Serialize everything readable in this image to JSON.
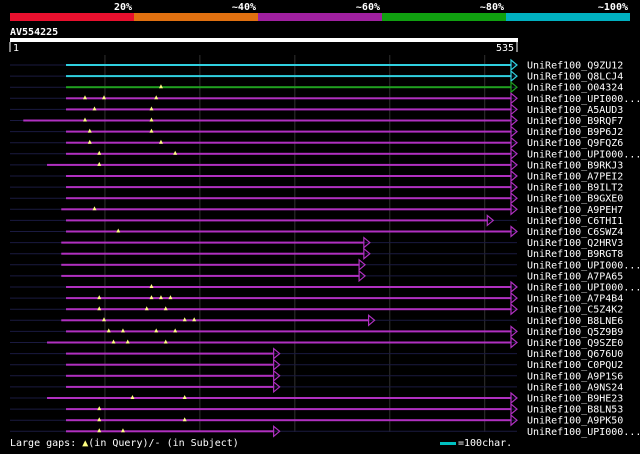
{
  "colors": {
    "band_red": "#e8102e",
    "band_orange": "#e07010",
    "band_purple": "#a020a0",
    "band_green": "#10a010",
    "band_cyan": "#00b0c0",
    "hit_purple": "#b030c0",
    "hit_cyan": "#30d0e0",
    "hit_green": "#20a020",
    "gap_marker": "#ffff80",
    "dashed": "#808080"
  },
  "identity_scale": {
    "labels": [
      "20%",
      "~40%",
      "~60%",
      "~80%",
      "~100%"
    ]
  },
  "query": {
    "name": "AV554225",
    "start_label": "1",
    "end_label": "535",
    "length": 535
  },
  "hits": [
    {
      "name": "UniRef100_Q9ZU12",
      "start": 60,
      "end": 535,
      "color": "cyan",
      "gaps": []
    },
    {
      "name": "UniRef100_Q8LCJ4",
      "start": 60,
      "end": 535,
      "color": "cyan",
      "gaps": []
    },
    {
      "name": "UniRef100_O04324",
      "start": 60,
      "end": 535,
      "color": "green",
      "gaps": [
        160
      ]
    },
    {
      "name": "UniRef100_UPI000...",
      "start": 60,
      "end": 535,
      "color": "purple",
      "gaps": [
        80,
        100,
        155
      ]
    },
    {
      "name": "UniRef100_A5AUD3",
      "start": 60,
      "end": 535,
      "color": "purple",
      "gaps": [
        90,
        150
      ]
    },
    {
      "name": "UniRef100_B9RQF7",
      "start": 15,
      "end": 535,
      "color": "purple",
      "gaps": [
        80,
        150
      ]
    },
    {
      "name": "UniRef100_B9P6J2",
      "start": 60,
      "end": 535,
      "color": "purple",
      "gaps": [
        85,
        150
      ]
    },
    {
      "name": "UniRef100_Q9FQZ6",
      "start": 60,
      "end": 535,
      "color": "purple",
      "gaps": [
        85,
        160
      ]
    },
    {
      "name": "UniRef100_UPI000...",
      "start": 60,
      "end": 535,
      "color": "purple",
      "gaps": [
        95,
        175
      ]
    },
    {
      "name": "UniRef100_B9RKJ3",
      "start": 40,
      "end": 535,
      "color": "purple",
      "gaps": [
        95
      ]
    },
    {
      "name": "UniRef100_A7PEI2",
      "start": 60,
      "end": 535,
      "color": "purple",
      "gaps": []
    },
    {
      "name": "UniRef100_B9ILT2",
      "start": 60,
      "end": 535,
      "color": "purple",
      "gaps": []
    },
    {
      "name": "UniRef100_B9GXE0",
      "start": 60,
      "end": 535,
      "color": "purple",
      "gaps": []
    },
    {
      "name": "UniRef100_A9PEH7",
      "start": 55,
      "end": 535,
      "color": "purple",
      "gaps": [
        90
      ]
    },
    {
      "name": "UniRef100_C6THI1",
      "start": 60,
      "end": 510,
      "color": "purple",
      "gaps": []
    },
    {
      "name": "UniRef100_C6SWZ4",
      "start": 60,
      "end": 535,
      "color": "purple",
      "gaps": [
        115
      ]
    },
    {
      "name": "UniRef100_Q2HRV3",
      "start": 55,
      "end": 380,
      "color": "purple",
      "gaps": []
    },
    {
      "name": "UniRef100_B9RGT8",
      "start": 55,
      "end": 380,
      "color": "purple",
      "gaps": []
    },
    {
      "name": "UniRef100_UPI000...",
      "start": 55,
      "end": 375,
      "color": "purple",
      "gaps": []
    },
    {
      "name": "UniRef100_A7PA65",
      "start": 55,
      "end": 375,
      "color": "purple",
      "gaps": []
    },
    {
      "name": "UniRef100_UPI000...",
      "start": 60,
      "end": 535,
      "color": "purple",
      "gaps": [
        150
      ]
    },
    {
      "name": "UniRef100_A7P4B4",
      "start": 60,
      "end": 535,
      "color": "purple",
      "gaps": [
        95,
        150,
        160,
        170
      ]
    },
    {
      "name": "UniRef100_C5Z4K2",
      "start": 60,
      "end": 535,
      "color": "purple",
      "gaps": [
        95,
        145,
        165
      ]
    },
    {
      "name": "UniRef100_B8LNE6",
      "start": 55,
      "end": 385,
      "color": "purple",
      "gaps": [
        100,
        185,
        195
      ]
    },
    {
      "name": "UniRef100_Q5Z9B9",
      "start": 60,
      "end": 535,
      "color": "purple",
      "gaps": [
        105,
        120,
        155,
        175
      ]
    },
    {
      "name": "UniRef100_Q9SZE0",
      "start": 40,
      "end": 535,
      "color": "purple",
      "gaps": [
        110,
        125,
        165
      ]
    },
    {
      "name": "UniRef100_Q676U0",
      "start": 60,
      "end": 285,
      "color": "purple",
      "gaps": []
    },
    {
      "name": "UniRef100_C0PQU2",
      "start": 60,
      "end": 285,
      "color": "purple",
      "gaps": []
    },
    {
      "name": "UniRef100_A9P1S6",
      "start": 60,
      "end": 285,
      "color": "purple",
      "gaps": []
    },
    {
      "name": "UniRef100_A9NS24",
      "start": 60,
      "end": 285,
      "color": "purple",
      "gaps": []
    },
    {
      "name": "UniRef100_B9HE23",
      "start": 40,
      "end": 535,
      "color": "purple",
      "gaps": [
        130,
        185
      ]
    },
    {
      "name": "UniRef100_B8LN53",
      "start": 60,
      "end": 535,
      "color": "purple",
      "gaps": [
        95
      ]
    },
    {
      "name": "UniRef100_A9PK50",
      "start": 60,
      "end": 535,
      "color": "purple",
      "gaps": [
        95,
        185
      ]
    },
    {
      "name": "UniRef100_UPI000...",
      "start": 60,
      "end": 285,
      "color": "purple",
      "gaps": [
        95,
        120
      ]
    }
  ],
  "legend": {
    "prefix": "Large gaps: ",
    "query_marker": "▲",
    "query_text": "(in Query)/",
    "subject_marker": "-",
    "subject_text": " (in Subject)",
    "scale_text": "=100char."
  }
}
